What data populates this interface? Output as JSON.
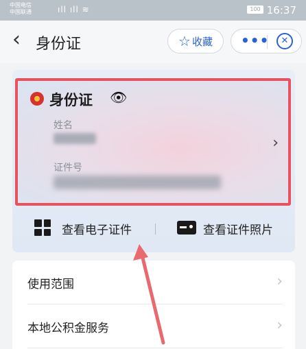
{
  "status_bar": {
    "carrier_1": "中国电信",
    "carrier_2": "中国联通",
    "battery": "100",
    "time": "16:37"
  },
  "navbar": {
    "back_icon": "chevron-left-icon",
    "title": "身份证",
    "favorite_label": "收藏",
    "favorite_icon": "star-outline-icon",
    "more_icon": "more-dots-icon",
    "close_icon": "close-circle-icon",
    "accent": "#2a60d8"
  },
  "id_card": {
    "title": "身份证",
    "emblem_icon": "national-emblem-icon",
    "eye_icon": "eye-icon",
    "name_label": "姓名",
    "id_label": "证件号",
    "highlight_color": "#e8515d"
  },
  "actions": {
    "view_e_cert": "查看电子证件",
    "view_photo": "查看证件照片"
  },
  "list_items": [
    {
      "label": "使用范围"
    },
    {
      "label": "本地公积金服务"
    }
  ]
}
